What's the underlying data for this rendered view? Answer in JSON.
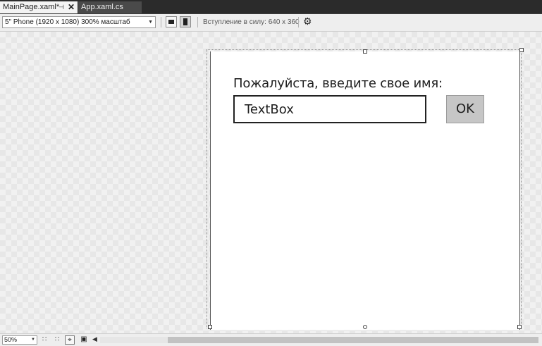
{
  "tabs": [
    {
      "label": "MainPage.xaml*"
    },
    {
      "label": "App.xaml.cs"
    }
  ],
  "toolbar": {
    "device_value": "5\" Phone (1920 x 1080) 300% масштаб",
    "effective_size": "Вступление в силу: 640 x 360"
  },
  "page": {
    "prompt": "Пожалуйста, введите свое имя:",
    "textbox_value": "TextBox",
    "ok_label": "OK"
  },
  "bottombar": {
    "zoom_value": "50%"
  },
  "icons": {
    "pin": "pin-icon",
    "close": "close-icon",
    "landscape": "landscape-orientation-icon",
    "portrait": "portrait-orientation-icon",
    "settings": "gear-icon",
    "grid_small": "small-grid-icon",
    "grid_large": "large-grid-icon",
    "snap": "snap-to-gridlines-icon",
    "artboard": "artboard-background-icon",
    "scroll_left": "scroll-left-icon"
  },
  "colors": {
    "tabstrip_bg": "#2b2b2b",
    "active_tab_bg": "#f3f3f3",
    "button_bg": "#c6c6c6"
  }
}
